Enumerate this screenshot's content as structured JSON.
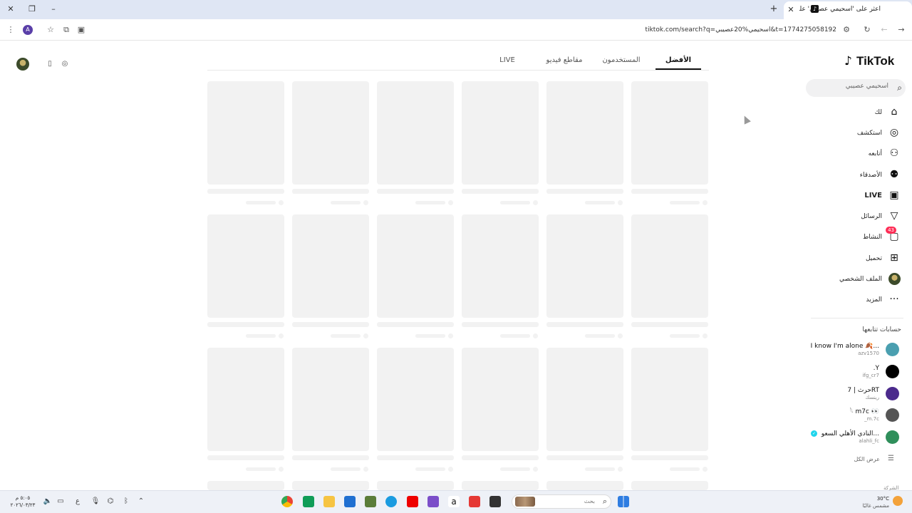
{
  "browser": {
    "tab_title": "اعثر على 'اسحيمي عصيبي' على",
    "tab_favicon": "tiktok-icon",
    "url": "tiktok.com/search?q=اسحيمي%20عصيبي&t=1774275058192",
    "profile_letter": "A"
  },
  "sidebar": {
    "logo": "TikTok",
    "search_value": "اسحيمي عصيبي",
    "items": [
      {
        "label": "لك",
        "icon": "home-icon"
      },
      {
        "label": "استكشف",
        "icon": "compass-icon"
      },
      {
        "label": "أتابعه",
        "icon": "user-plus-icon"
      },
      {
        "label": "الأصدقاء",
        "icon": "friends-icon"
      },
      {
        "label": "LIVE",
        "icon": "live-icon"
      },
      {
        "label": "الرسائل",
        "icon": "send-icon"
      },
      {
        "label": "النشاط",
        "icon": "activity-icon",
        "badge": "43"
      },
      {
        "label": "تحميل",
        "icon": "upload-icon"
      },
      {
        "label": "الملف الشخصي",
        "icon": "profile-avatar"
      },
      {
        "label": "المزيد",
        "icon": "more-icon"
      }
    ],
    "following_title": "حسابات تتابعها",
    "accounts": [
      {
        "name": "I know I'm alone 🍂...",
        "handle": "azv1570",
        "color": "#4a9fb0"
      },
      {
        "name": ".Y",
        "handle": "ifg_cr7",
        "color": "#000000"
      },
      {
        "name": "حرث | 7RT",
        "handle": "رينسك",
        "color": "#4b2a8c"
      },
      {
        "name": "𓆩 m7c 👀",
        "handle": "_m.7c",
        "color": "#555555"
      },
      {
        "name": "النادي الأهلي السعو...",
        "handle": "alahli_fc",
        "color": "#2f8f5b",
        "verified": true
      }
    ],
    "see_all": "عرض الكل",
    "company": "الشركة"
  },
  "search_tabs": [
    {
      "label": "الأفضل",
      "active": true
    },
    {
      "label": "المستخدمون",
      "active": false
    },
    {
      "label": "مقاطع فيديو",
      "active": false
    },
    {
      "label": "LIVE",
      "active": false
    }
  ],
  "taskbar": {
    "search_placeholder": "بحث",
    "weather_temp": "30°C",
    "weather_desc": "مشمس غالبًا",
    "time": "٥:٠٥ م",
    "date": "٢٠٢٦/٠٣/٢٣"
  }
}
